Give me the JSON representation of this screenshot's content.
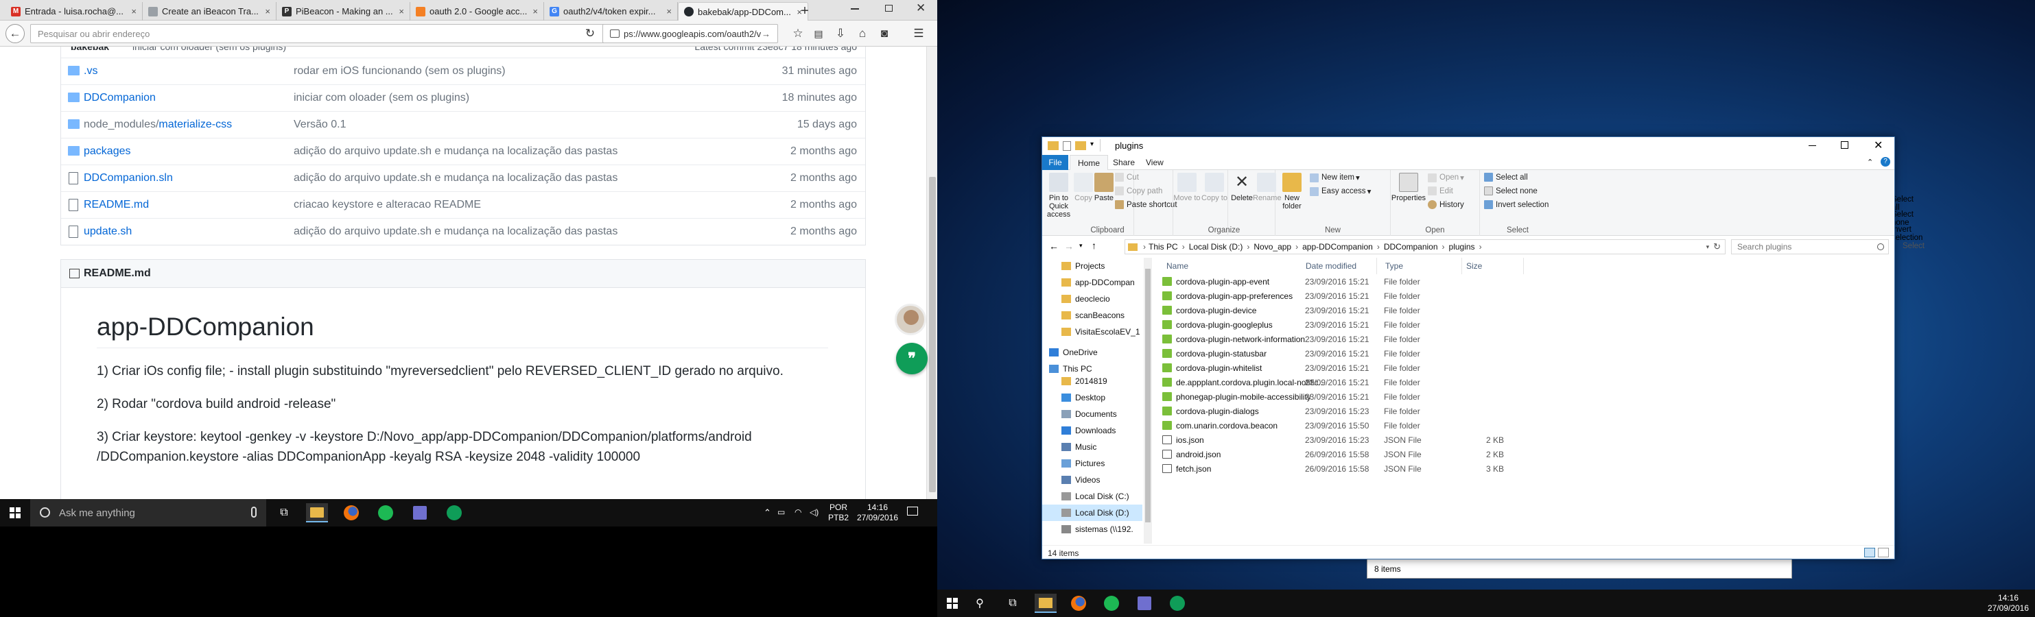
{
  "left_screen": {
    "tabs": [
      {
        "title": "Entrada - luisa.rocha@...",
        "icon": "gmail-icon",
        "color": "#d93025",
        "glyph": "M"
      },
      {
        "title": "Create an iBeacon Tra...",
        "icon": "page-icon",
        "color": "#9aa0a6",
        "glyph": ""
      },
      {
        "title": "PiBeacon - Making an ...",
        "icon": "page-icon",
        "color": "#333333",
        "glyph": "P"
      },
      {
        "title": "oauth 2.0 - Google acc...",
        "icon": "stackoverflow-icon",
        "color": "#f48024",
        "glyph": ""
      },
      {
        "title": "oauth2/v4/token expir...",
        "icon": "google-icon",
        "color": "#4285f4",
        "glyph": "G"
      },
      {
        "title": "bakebak/app-DDCom...",
        "icon": "github-icon",
        "color": "#24292e",
        "glyph": ""
      }
    ],
    "navbar": {
      "search_placeholder": "Pesquisar ou abrir endereço",
      "url": "ps://www.googleapis.com/oauth2/v"
    },
    "file_list_header": {
      "author": "bakebak",
      "message": "iniciar com oloader (sem os plugins)",
      "latest": "Latest commit 23e8c7 18 minutes ago"
    },
    "files": [
      {
        "name": ".vs",
        "prefix": "",
        "type": "folder",
        "commit": "rodar em iOS funcionando (sem os plugins)",
        "age": "31 minutes ago"
      },
      {
        "name": "DDCompanion",
        "prefix": "",
        "type": "folder",
        "commit": "iniciar com oloader (sem os plugins)",
        "age": "18 minutes ago"
      },
      {
        "name": "materialize-css",
        "prefix": "node_modules/",
        "type": "folder",
        "commit": "Versão 0.1",
        "age": "15 days ago"
      },
      {
        "name": "packages",
        "prefix": "",
        "type": "folder",
        "commit": "adição do arquivo update.sh e mudança na localização das pastas",
        "age": "2 months ago"
      },
      {
        "name": "DDCompanion.sln",
        "prefix": "",
        "type": "file",
        "commit": "adição do arquivo update.sh e mudança na localização das pastas",
        "age": "2 months ago"
      },
      {
        "name": "README.md",
        "prefix": "",
        "type": "file",
        "commit": "criacao keystore e alteracao README",
        "age": "2 months ago"
      },
      {
        "name": "update.sh",
        "prefix": "",
        "type": "file",
        "commit": "adição do arquivo update.sh e mudança na localização das pastas",
        "age": "2 months ago"
      }
    ],
    "readme": {
      "header": "README.md",
      "title": "app-DDCompanion",
      "p1": "1) Criar iOs config file; - install plugin substituindo \"myreversedclient\" pelo REVERSED_CLIENT_ID gerado no arquivo.",
      "p2": "2) Rodar \"cordova build android -release\"",
      "p3a": "3) Criar keystore: keytool -genkey -v -keystore D:/Novo_app/app-DDCompanion/DDCompanion/platforms/android",
      "p3b": "/DDCompanion.keystore -alias DDCompanionApp -keyalg RSA -keysize 2048 -validity 100000"
    },
    "taskbar": {
      "search_text": "Ask me anything",
      "lang": "POR",
      "lang2": "PTB2",
      "time": "14:16",
      "date": "27/09/2016"
    }
  },
  "explorer": {
    "title": "plugins",
    "ribbon_tabs": [
      "File",
      "Home",
      "Share",
      "View"
    ],
    "clipboard": {
      "pin": "Pin to Quick access",
      "copy": "Copy",
      "paste": "Paste",
      "cut": "Cut",
      "copy_path": "Copy path",
      "paste_shortcut": "Paste shortcut",
      "label": "Clipboard"
    },
    "organize": {
      "move": "Move to",
      "copy": "Copy to",
      "delete": "Delete",
      "rename": "Rename",
      "label": "Organize"
    },
    "new": {
      "folder": "New folder",
      "new_item": "New item",
      "easy_access": "Easy access",
      "label": "New"
    },
    "open": {
      "properties": "Properties",
      "open": "Open",
      "edit": "Edit",
      "history": "History",
      "label": "Open"
    },
    "select": {
      "all": "Select all",
      "none": "Select none",
      "invert": "Invert selection",
      "label": "Select"
    },
    "breadcrumb": [
      "This PC",
      "Local Disk (D:)",
      "Novo_app",
      "app-DDCompanion",
      "DDCompanion",
      "plugins"
    ],
    "search_placeholder": "Search plugins",
    "nav": [
      {
        "label": "Projects",
        "icon": "folder-icon"
      },
      {
        "label": "app-DDCompan",
        "icon": "folder-icon"
      },
      {
        "label": "deoclecio",
        "icon": "folder-icon"
      },
      {
        "label": "scanBeacons",
        "icon": "folder-icon"
      },
      {
        "label": "VisitaEscolaEV_1",
        "icon": "folder-icon"
      },
      {
        "label": "OneDrive",
        "icon": "cloud-icon"
      },
      {
        "label": "This PC",
        "icon": "computer-icon"
      },
      {
        "label": "2014819",
        "icon": "folder-icon"
      },
      {
        "label": "Desktop",
        "icon": "desktop-icon"
      },
      {
        "label": "Documents",
        "icon": "documents-icon"
      },
      {
        "label": "Downloads",
        "icon": "downloads-icon"
      },
      {
        "label": "Music",
        "icon": "music-icon"
      },
      {
        "label": "Pictures",
        "icon": "pictures-icon"
      },
      {
        "label": "Videos",
        "icon": "videos-icon"
      },
      {
        "label": "Local Disk (C:)",
        "icon": "drive-icon"
      },
      {
        "label": "Local Disk (D:)",
        "icon": "drive-icon"
      },
      {
        "label": "sistemas (\\\\192.",
        "icon": "network-drive-icon"
      }
    ],
    "columns": [
      "Name",
      "Date modified",
      "Type",
      "Size"
    ],
    "files": [
      {
        "name": "cordova-plugin-app-event",
        "date": "23/09/2016 15:21",
        "type": "File folder",
        "size": ""
      },
      {
        "name": "cordova-plugin-app-preferences",
        "date": "23/09/2016 15:21",
        "type": "File folder",
        "size": ""
      },
      {
        "name": "cordova-plugin-device",
        "date": "23/09/2016 15:21",
        "type": "File folder",
        "size": ""
      },
      {
        "name": "cordova-plugin-googleplus",
        "date": "23/09/2016 15:21",
        "type": "File folder",
        "size": ""
      },
      {
        "name": "cordova-plugin-network-information",
        "date": "23/09/2016 15:21",
        "type": "File folder",
        "size": ""
      },
      {
        "name": "cordova-plugin-statusbar",
        "date": "23/09/2016 15:21",
        "type": "File folder",
        "size": ""
      },
      {
        "name": "cordova-plugin-whitelist",
        "date": "23/09/2016 15:21",
        "type": "File folder",
        "size": ""
      },
      {
        "name": "de.appplant.cordova.plugin.local-notific...",
        "date": "23/09/2016 15:21",
        "type": "File folder",
        "size": ""
      },
      {
        "name": "phonegap-plugin-mobile-accessibility",
        "date": "23/09/2016 15:21",
        "type": "File folder",
        "size": ""
      },
      {
        "name": "cordova-plugin-dialogs",
        "date": "23/09/2016 15:23",
        "type": "File folder",
        "size": ""
      },
      {
        "name": "com.unarin.cordova.beacon",
        "date": "23/09/2016 15:50",
        "type": "File folder",
        "size": ""
      },
      {
        "name": "ios.json",
        "date": "23/09/2016 15:23",
        "type": "JSON File",
        "size": "2 KB"
      },
      {
        "name": "android.json",
        "date": "26/09/2016 15:58",
        "type": "JSON File",
        "size": "2 KB"
      },
      {
        "name": "fetch.json",
        "date": "26/09/2016 15:58",
        "type": "JSON File",
        "size": "3 KB"
      }
    ],
    "status": "14 items"
  },
  "bg_window": {
    "select_all": "Select all",
    "select_none": "Select none",
    "invert": "Invert selection",
    "label": "Select",
    "status": "8 items"
  },
  "right_taskbar": {
    "time": "14:16",
    "date": "27/09/2016"
  },
  "colors": {
    "folder": "#e8b84a",
    "link": "#0366d6",
    "win_blue": "#1979ca",
    "taskbar": "#101010"
  }
}
